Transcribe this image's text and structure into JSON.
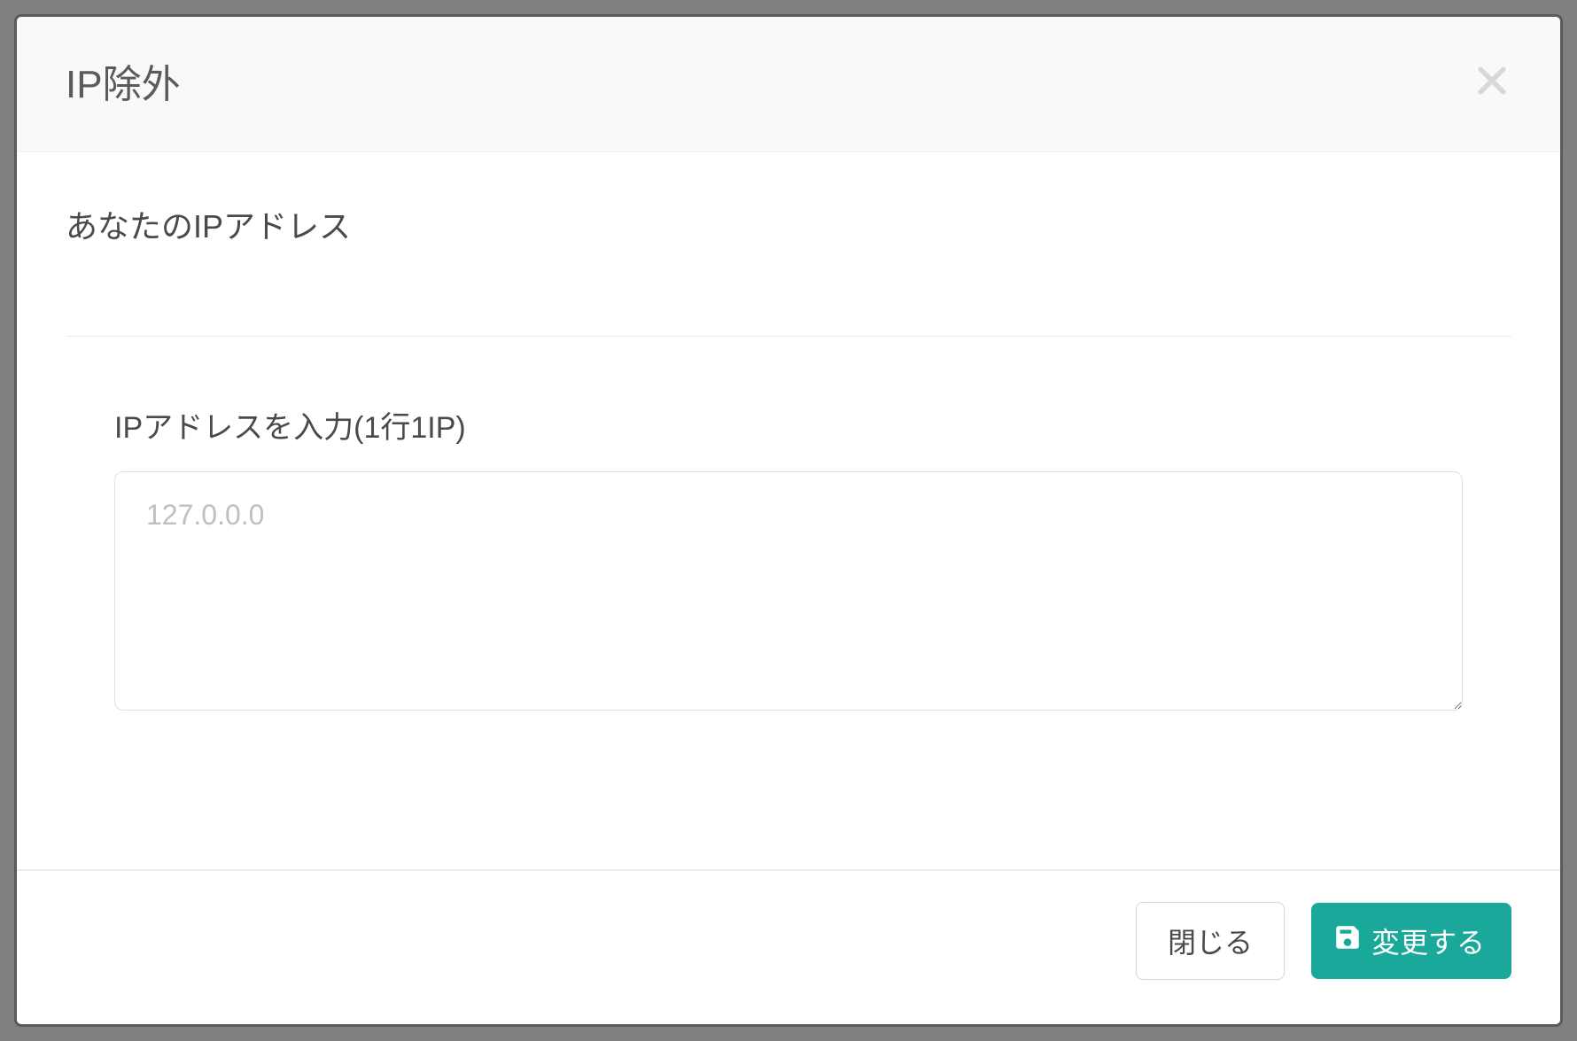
{
  "modal": {
    "title": "IP除外",
    "sectionLabel": "あなたのIPアドレス",
    "inputLabel": "IPアドレスを入力(1行1IP)",
    "textareaPlaceholder": "127.0.0.0",
    "textareaValue": ""
  },
  "footer": {
    "closeLabel": "閉じる",
    "saveLabel": "変更する"
  },
  "colors": {
    "accent": "#1aa89a",
    "border": "#e0e0e0",
    "text": "#4a4a4a"
  }
}
